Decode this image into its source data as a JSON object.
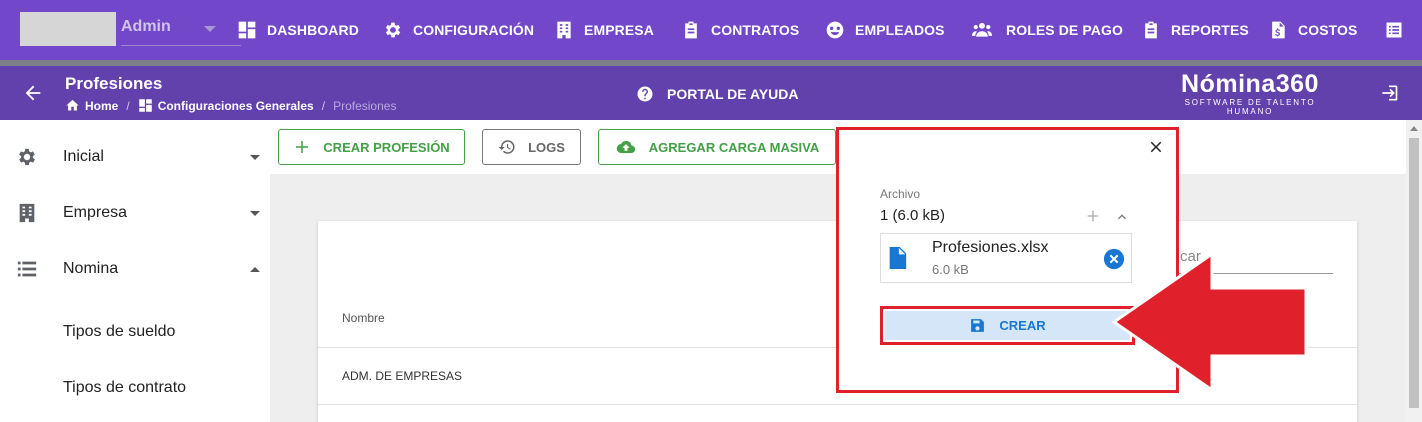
{
  "colors": {
    "primary": "#7347c9",
    "subbar": "#6241ac",
    "green": "#43a047",
    "blue": "#1976d2",
    "highlight_red": "#e0202a"
  },
  "user": {
    "name": "Admin"
  },
  "nav": {
    "items": [
      {
        "label": "DASHBOARD",
        "icon": "dashboard-icon"
      },
      {
        "label": "CONFIGURACIÓN",
        "icon": "gear-icon"
      },
      {
        "label": "EMPRESA",
        "icon": "building-icon"
      },
      {
        "label": "CONTRATOS",
        "icon": "clipboard-icon"
      },
      {
        "label": "EMPLEADOS",
        "icon": "employees-icon"
      },
      {
        "label": "ROLES DE PAGO",
        "icon": "group-icon"
      },
      {
        "label": "REPORTES",
        "icon": "clipboard-icon"
      },
      {
        "label": "COSTOS",
        "icon": "invoice-dollar-icon"
      }
    ]
  },
  "header": {
    "title": "Profesiones",
    "breadcrumb": [
      "Home",
      "Configuraciones Generales",
      "Profesiones"
    ],
    "help": "PORTAL DE AYUDA",
    "brand_name": "Nómina360",
    "brand_tagline": "SOFTWARE DE TALENTO HUMANO"
  },
  "sidebar": {
    "items": [
      {
        "label": "Inicial",
        "icon": "gear-icon",
        "expanded": false
      },
      {
        "label": "Empresa",
        "icon": "building-icon",
        "expanded": false
      },
      {
        "label": "Nomina",
        "icon": "list-icon",
        "expanded": true
      },
      {
        "label": "Tipos de sueldo"
      },
      {
        "label": "Tipos de contrato"
      }
    ]
  },
  "toolbar": {
    "create": "CREAR PROFESIÓN",
    "logs": "LOGS",
    "bulk": "AGREGAR CARGA MASIVA"
  },
  "table": {
    "search_placeholder": "car",
    "columns": [
      "Nombre"
    ],
    "rows": [
      [
        "ADM. DE EMPRESAS"
      ]
    ]
  },
  "dialog": {
    "label": "Archivo",
    "count": "1 (6.0 kB)",
    "file_name": "Profesiones.xlsx",
    "file_size": "6.0 kB",
    "submit": "CREAR"
  }
}
